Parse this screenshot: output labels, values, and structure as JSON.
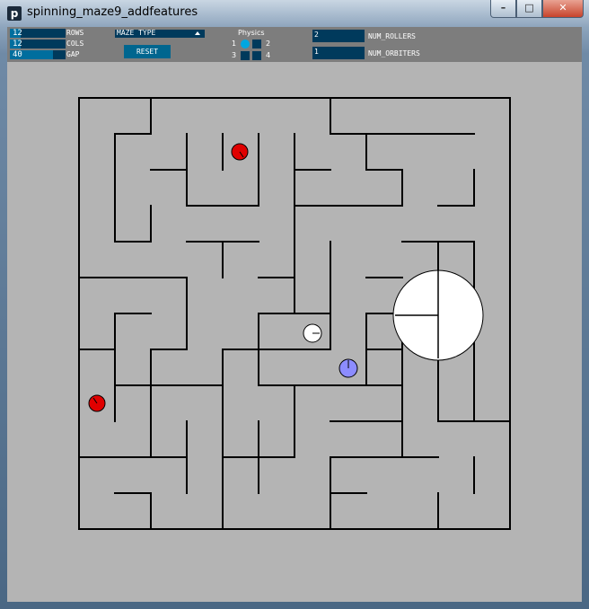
{
  "window": {
    "title": "spinning_maze9_addfeatures",
    "app_icon_glyph": "p",
    "controls": {
      "minimize": "–",
      "maximize": "□",
      "close": "✕"
    }
  },
  "controls": {
    "rows": {
      "value": "12",
      "label": "ROWS",
      "fraction": 0.2
    },
    "cols": {
      "value": "12",
      "label": "COLS",
      "fraction": 0.2
    },
    "gap": {
      "value": "40",
      "label": "GAP",
      "fraction": 0.9
    },
    "maze_type": {
      "label": "MAZE TYPE"
    },
    "reset": {
      "label": "RESET"
    },
    "physics": {
      "title": "Physics",
      "options": [
        "1",
        "2",
        "3",
        "4"
      ],
      "selected": "1"
    },
    "num_rollers": {
      "value": "2",
      "label": "NUM_ROLLERS"
    },
    "num_orbiters": {
      "value": "1",
      "label": "NUM_ORBITERS"
    }
  },
  "colors": {
    "client_bg": "#b4b4b4",
    "control_bar": "#7d7d7d",
    "control_dark": "#003a5c",
    "control_accent": "#006e9e",
    "wall": "#000000",
    "roller_red": "#e00000",
    "roller_blue": "#8c8cff",
    "orbiter": "#ffffff"
  }
}
